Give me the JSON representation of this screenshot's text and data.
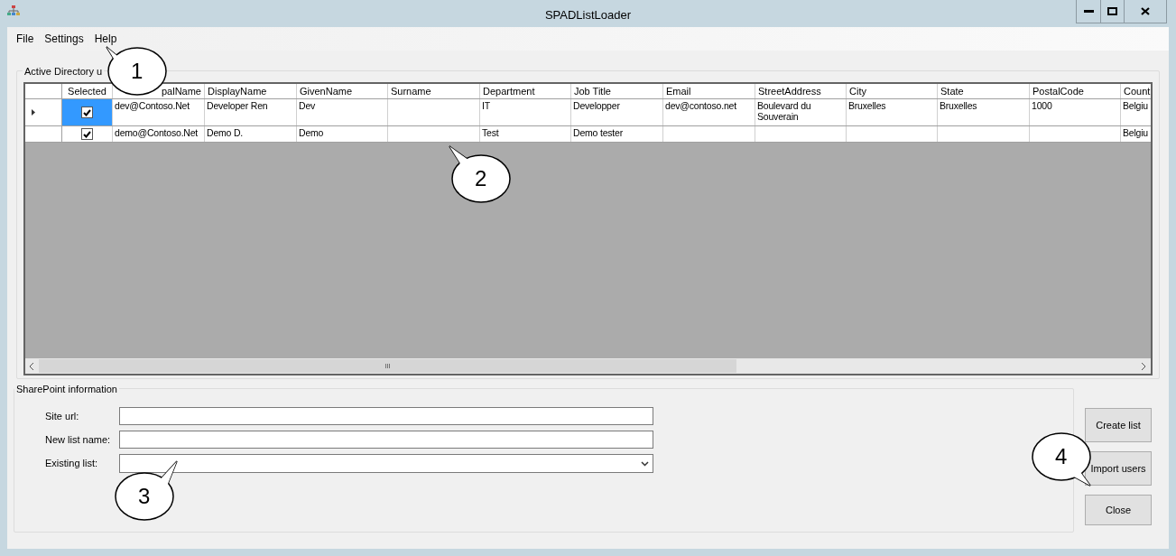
{
  "window": {
    "title": "SPADListLoader"
  },
  "menu": [
    "File",
    "Settings",
    "Help"
  ],
  "users_group": {
    "title": "Active Directory u",
    "grid": {
      "checkbox_column": "Selected",
      "columns": [
        "palName",
        "DisplayName",
        "GivenName",
        "Surname",
        "Department",
        "Job Title",
        "Email",
        "StreetAddress",
        "City",
        "State",
        "PostalCode",
        "Count"
      ],
      "rows": [
        {
          "current": true,
          "checked": true,
          "cells": [
            "dev@Contoso.Net",
            "Developer Ren",
            "Dev",
            null,
            "IT",
            "Developper",
            "dev@contoso.net",
            "Boulevard du Souverain",
            "Bruxelles",
            "Bruxelles",
            "1000",
            "Belgiu"
          ]
        },
        {
          "current": false,
          "checked": true,
          "cells": [
            "demo@Contoso.Net",
            "Demo D.",
            "Demo",
            null,
            "Test",
            "Demo tester",
            null,
            null,
            null,
            null,
            null,
            "Belgiu"
          ]
        }
      ],
      "scrollbar_grip": "III"
    }
  },
  "sharepoint_group": {
    "title": "SharePoint information",
    "fields": [
      {
        "label": "Site url:",
        "kind": "text"
      },
      {
        "label": "New list name:",
        "kind": "text"
      },
      {
        "label": "Existing list:",
        "kind": "dropdown"
      }
    ]
  },
  "buttons": [
    "Create list",
    "Import users",
    "Close"
  ],
  "callouts": [
    "1",
    "2",
    "3",
    "4"
  ]
}
